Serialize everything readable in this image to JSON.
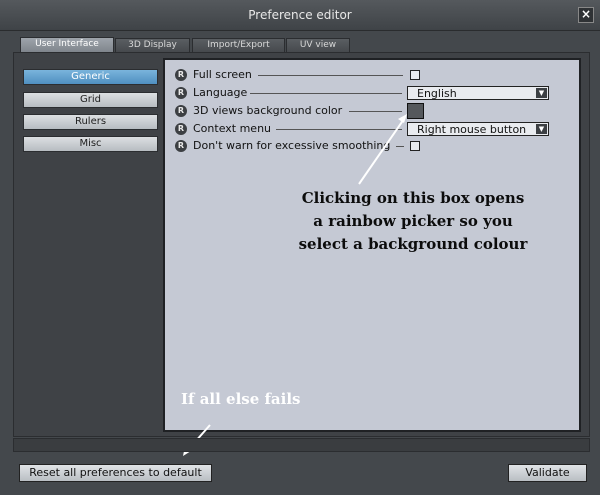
{
  "window": {
    "title": "Preference editor",
    "close_glyph": "×"
  },
  "tabs": [
    {
      "label": "User Interface",
      "active": true
    },
    {
      "label": "3D Display"
    },
    {
      "label": "Import/Export"
    },
    {
      "label": "UV view"
    }
  ],
  "sidebar": {
    "items": [
      {
        "label": "Generic",
        "active": true
      },
      {
        "label": "Grid"
      },
      {
        "label": "Rulers"
      },
      {
        "label": "Misc"
      }
    ]
  },
  "settings": {
    "reset_glyph": "R",
    "rows": [
      {
        "label": "Full screen",
        "control": "checkbox",
        "checked": false
      },
      {
        "label": "Language",
        "control": "select",
        "value": "English"
      },
      {
        "label": "3D views background color",
        "control": "color",
        "color": "#55585c"
      },
      {
        "label": "Context menu",
        "control": "select",
        "value": "Right mouse button"
      },
      {
        "label": "Don't warn for excessive smoothing",
        "control": "checkbox",
        "checked": false
      }
    ]
  },
  "annotations": {
    "color_note": {
      "line1": "Clicking on this box opens",
      "line2": "a rainbow picker so you",
      "line3": "select a background colour"
    },
    "reset_note": "If all else fails"
  },
  "footer": {
    "reset_label": "Reset all preferences to default",
    "validate_label": "Validate"
  },
  "icons": {
    "dropdown": "chevron-down-icon",
    "reset": "reset-icon",
    "arrow": "annotation-arrow"
  },
  "colors": {
    "active_tab": "#8c9299",
    "active_sidebar": "#5b9bcc",
    "panel_bg": "#c5c9d4",
    "window_bg": "#44484c"
  }
}
